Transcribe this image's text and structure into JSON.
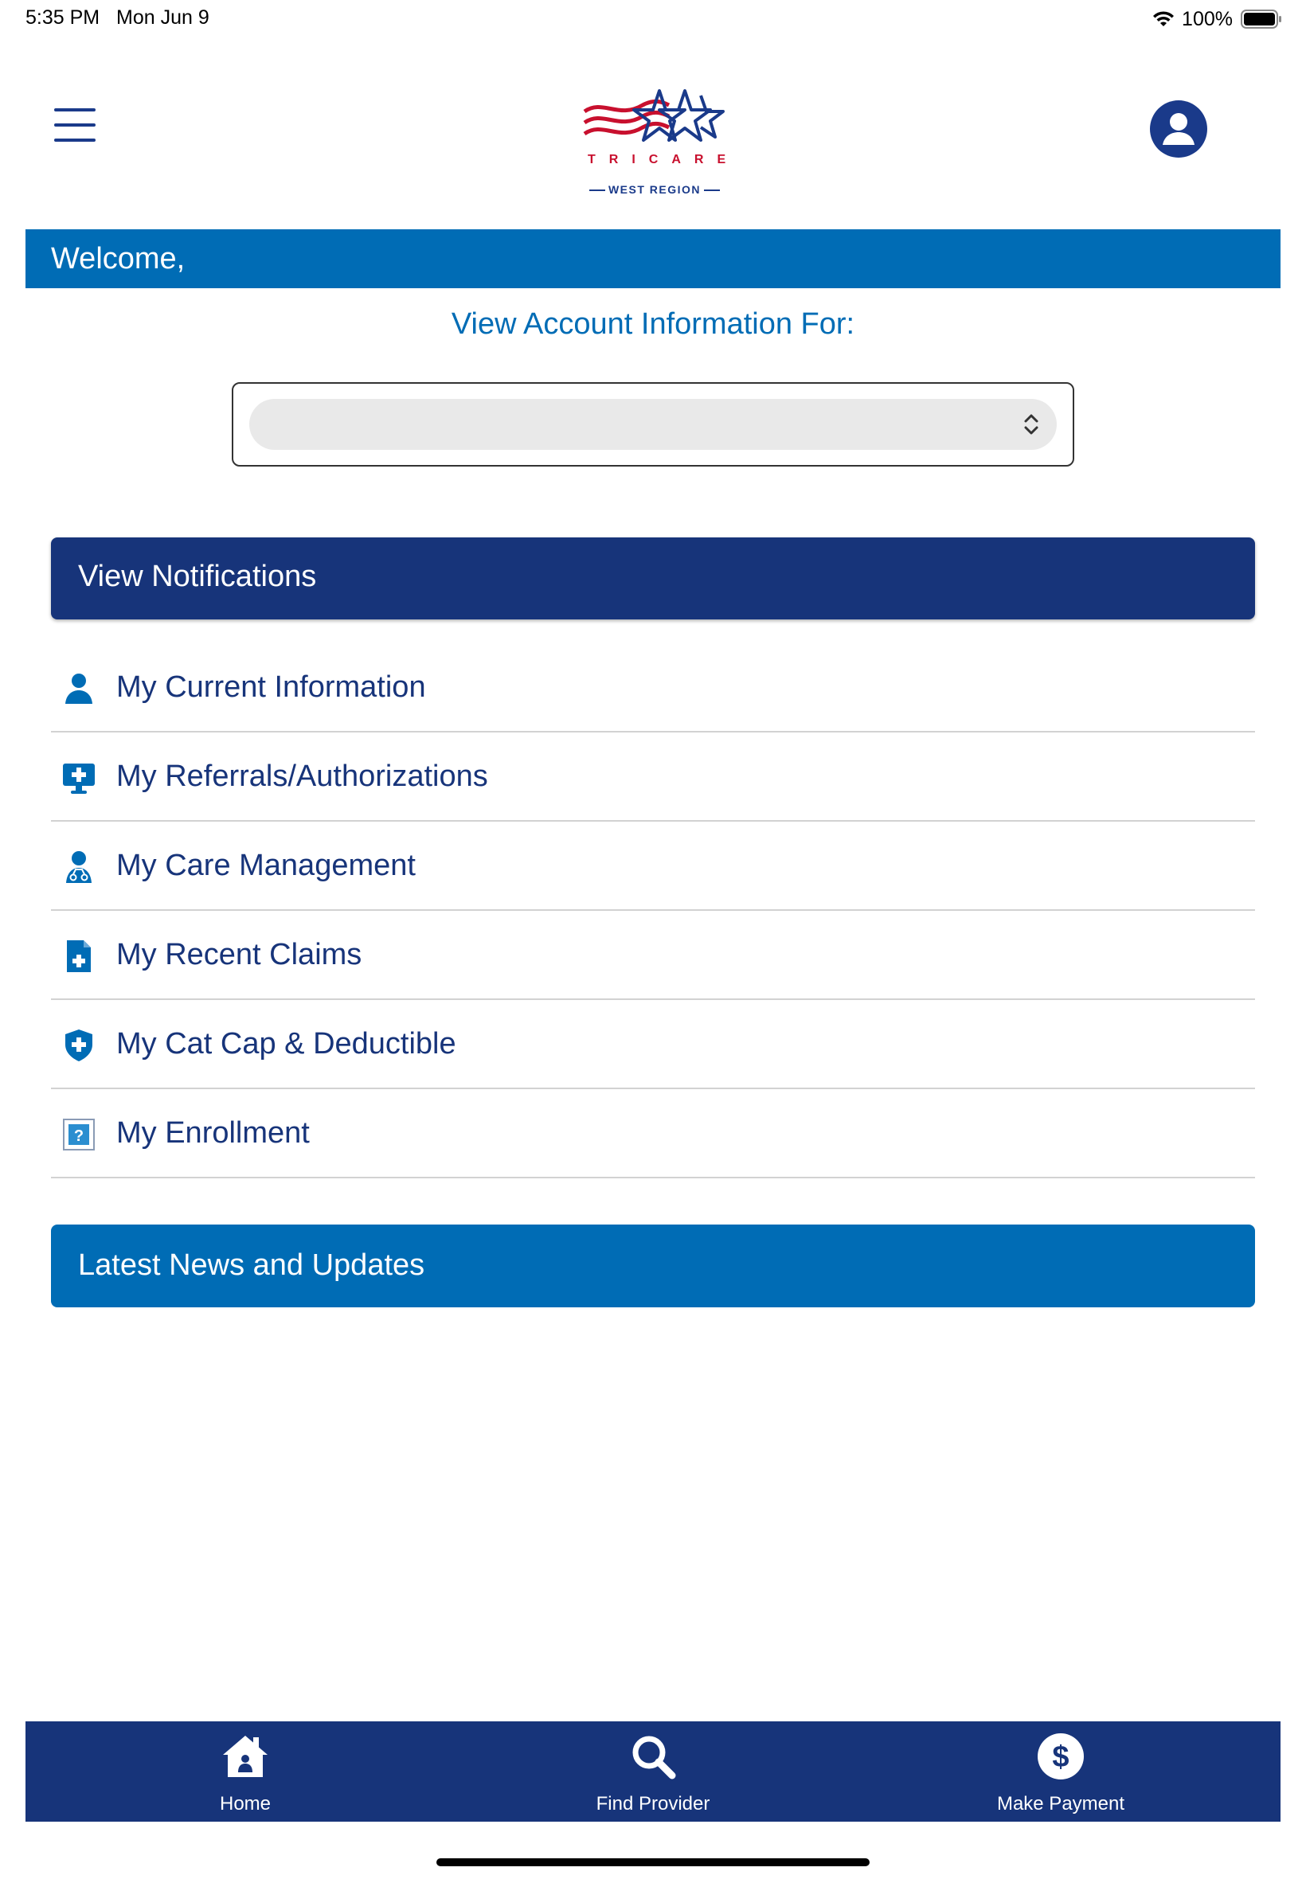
{
  "status_bar": {
    "time": "5:35 PM",
    "date": "Mon Jun 9",
    "battery": "100%"
  },
  "header": {
    "logo_name": "TRICARE",
    "logo_region": "WEST REGION",
    "menu_icon": "hamburger-menu-icon",
    "profile_icon": "user-profile-icon"
  },
  "welcome": {
    "text": "Welcome,"
  },
  "account": {
    "label": "View Account Information For:",
    "selected_value": ""
  },
  "notifications": {
    "label": "View Notifications"
  },
  "menu": {
    "items": [
      {
        "label": "My Current Information",
        "icon": "person-icon"
      },
      {
        "label": "My Referrals/Authorizations",
        "icon": "medical-monitor-icon"
      },
      {
        "label": "My Care Management",
        "icon": "doctor-icon"
      },
      {
        "label": "My Recent Claims",
        "icon": "medical-file-icon"
      },
      {
        "label": "My Cat Cap & Deductible",
        "icon": "shield-plus-icon"
      },
      {
        "label": "My Enrollment",
        "icon": "question-box-icon"
      }
    ]
  },
  "news": {
    "label": "Latest News and Updates"
  },
  "tab_bar": {
    "tabs": [
      {
        "label": "Home",
        "icon": "home-icon"
      },
      {
        "label": "Find Provider",
        "icon": "search-icon"
      },
      {
        "label": "Make Payment",
        "icon": "dollar-icon"
      }
    ]
  },
  "colors": {
    "primary_blue": "#006cb5",
    "navy": "#17347a",
    "logo_red": "#c8102e"
  }
}
